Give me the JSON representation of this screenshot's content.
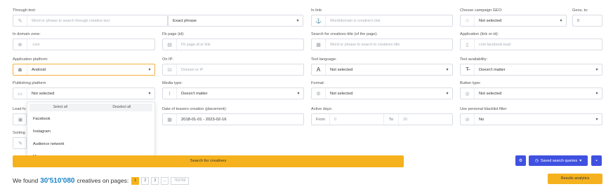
{
  "fields": {
    "through_text": {
      "label": "Through text:",
      "placeholder": "Word or phrase to search through creative text",
      "icon": "pencil-icon"
    },
    "phrase_mode": {
      "value": "Exact phrase"
    },
    "in_link": {
      "label": "In link:",
      "placeholder": "Word/domain in creative's link",
      "icon": "anchor-icon"
    },
    "campaign_geo": {
      "label": "Choose campaign GEO:",
      "value": "Not selected",
      "icon": "bank-icon"
    },
    "geos_to": {
      "label": "Geos, to:",
      "value": "0"
    },
    "domain_zone": {
      "label": "In domain zone:",
      "placeholder": ".com",
      "icon": "globe-icon"
    },
    "fb_page": {
      "label": "Fb page (id):",
      "placeholder": "Fb page-id or link",
      "icon": "page-icon"
    },
    "creatives_title": {
      "label": "Search for creatives title (of the page):",
      "placeholder": "Word or phrase to search in creatives title",
      "icon": "title-icon"
    },
    "application": {
      "label": "Application (link or id):",
      "placeholder": "com.facebook.lead",
      "icon": "phone-icon"
    },
    "app_platform": {
      "label": "Application platform:",
      "value": "Android",
      "icon": "android-icon"
    },
    "on_ip": {
      "label": "On IP:",
      "placeholder": "Domain or IP",
      "icon": "server-icon"
    },
    "text_language": {
      "label": "Text language:",
      "value": "Not selected",
      "icon": "font-icon"
    },
    "text_availability": {
      "label": "Text availability:",
      "value": "Doesn't matter",
      "icon": "text-strike-icon"
    },
    "publishing_platform": {
      "label": "Publishing platform",
      "value": "Not selected",
      "icon": "desktop-icon"
    },
    "media_type": {
      "label": "Media type:",
      "value": "Doesn't matter",
      "icon": "paperclip-icon"
    },
    "format": {
      "label": "Format:",
      "value": "Not selected",
      "icon": "gear-icon"
    },
    "button_type": {
      "label": "Button type:",
      "value": "Not selected",
      "icon": "circle-icon"
    },
    "lead_form": {
      "label": "Lead fo",
      "icon": "form-icon"
    },
    "teaser_date": {
      "label": "Date of teasers creation (placement):",
      "value": "2018-01-01 - 2023-02-16",
      "icon": "calendar-icon"
    },
    "active_days": {
      "label": "Active days:",
      "from_label": "From",
      "from_placeholder": "0",
      "to_label": "To",
      "to_placeholder": "30"
    },
    "blacklist": {
      "label": "Use personal blacklist filter",
      "value": "No",
      "icon": "ban-icon"
    },
    "sorting": {
      "label": "Sorting",
      "icon": "pencil-icon"
    }
  },
  "dropdown": {
    "select_all": "Select all",
    "deselect_all": "Deselect all",
    "items": [
      "Facebook",
      "Instagram",
      "Audience network",
      "Messenger"
    ]
  },
  "actions": {
    "search": "Search for creatives",
    "saved_queries": "Saved search queries",
    "results_analytics": "Results analytics"
  },
  "results": {
    "prefix": "We found",
    "count": "30'510'080",
    "suffix": "creatives on pages:",
    "pages": [
      "1",
      "2",
      "3",
      "...",
      "763760"
    ]
  },
  "colors": {
    "accent": "#f5b21e",
    "primary": "#3f51e0",
    "count": "#1b86c7"
  }
}
